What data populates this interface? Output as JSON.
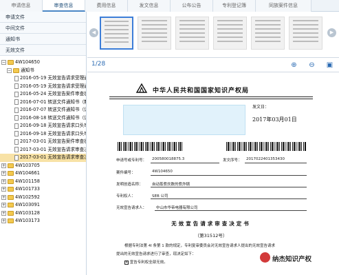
{
  "tabs": [
    {
      "label": "申请信息",
      "active": false
    },
    {
      "label": "审查信息",
      "active": true
    },
    {
      "label": "费用信息",
      "active": false
    },
    {
      "label": "发文信息",
      "active": false
    },
    {
      "label": "公布公告",
      "active": false
    },
    {
      "label": "专利登记簿",
      "active": false
    },
    {
      "label": "同族案件信息",
      "active": false
    }
  ],
  "categories": [
    "申请文件",
    "中间文件",
    "通知书",
    "无效文件"
  ],
  "tree": {
    "root": "4W104650",
    "folder": "通知书",
    "items": [
      "2016-05-19 无效宣告请求受理通",
      "2016-05-19 无效宣告请求受理通",
      "2016-05-24 无效宣告案件审查状",
      "2016-07-01 转送文件通知书（無",
      "2016-07-07 转送文件通知书（请",
      "2016-08-18 转送文件通知书（请",
      "2016-09-18 无效宣告请求口头审",
      "2016-09-18 无效宣告请求口头审",
      "2017-03-01 无效宣告案件审查状",
      "2017-03-01 无效宣告请求审查决",
      "2017-03-01 无效宣告请求审查决"
    ],
    "selected_index": 10,
    "others": [
      "4W103705",
      "4W104661",
      "4W101158",
      "4W101733",
      "4W102592",
      "4W103091",
      "4W103128",
      "4W103173"
    ]
  },
  "viewer": {
    "page_indicator": "1/28",
    "zoom_in_icon": "zoom-in-icon",
    "zoom_out_icon": "zoom-out-icon",
    "fit_icon": "fit-page-icon",
    "thumb_count": 6
  },
  "document": {
    "header": "中华人民共和国国家知识产权局",
    "fawen_label": "发文日：",
    "date": "2017年03月01日",
    "application_no_label": "申请号或专利号：",
    "application_no": "200580018875.3",
    "fawen_seq_label": "发文序号：",
    "fawen_seq": "2017022401353430",
    "case_no_label": "案件编号：",
    "case_no": "4W104650",
    "invention_name_label": "发明创造名称：",
    "invention_name": "自动蒸煮炊数的煮炸锅",
    "patentee_label": "专利权人：",
    "patentee": "SEB 公司",
    "requester_label": "无效宣告请求人：",
    "requester": "中山市华帝电器有限公司",
    "title": "无效宣告请求审查决定书",
    "decision_no": "（第31512号）",
    "para1": "根据专利法第 4l 条第 1 款的规定，专利复审委员会对无效宣告请求人提出的无效宣告请求",
    "para2": "提出的无效宣告请求进行了审查，现决定如下：",
    "option1": "宣告专利权全部无效。"
  },
  "watermark": "纳杰知识产权"
}
